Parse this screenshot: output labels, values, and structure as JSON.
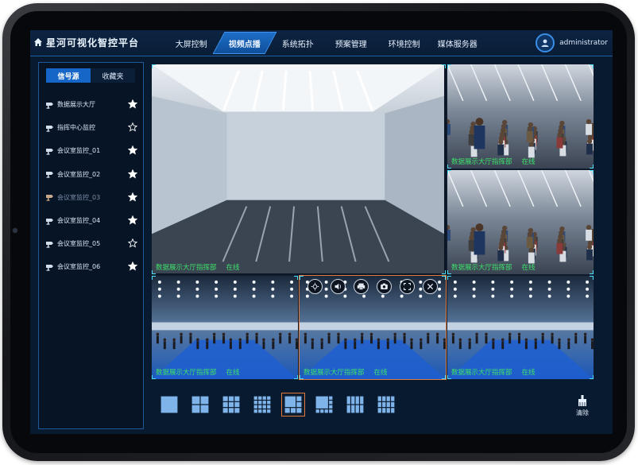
{
  "app": {
    "title": "星河可视化智控平台"
  },
  "nav": {
    "items": [
      "大屏控制",
      "视频点播",
      "系统拓扑",
      "预案管理",
      "环境控制",
      "媒体服务器"
    ],
    "active_index": 1
  },
  "user": {
    "name": "administrator"
  },
  "side": {
    "tabs": [
      "信号源",
      "收藏夹"
    ],
    "active_tab": 0,
    "sources": [
      {
        "label": "数据展示大厅",
        "favorite": true,
        "dim": false
      },
      {
        "label": "指挥中心监控",
        "favorite": false,
        "dim": false
      },
      {
        "label": "会议室监控_01",
        "favorite": true,
        "dim": false
      },
      {
        "label": "会议室监控_02",
        "favorite": true,
        "dim": false
      },
      {
        "label": "会议室监控_03",
        "favorite": true,
        "dim": true
      },
      {
        "label": "会议室监控_04",
        "favorite": true,
        "dim": false
      },
      {
        "label": "会议室监控_05",
        "favorite": false,
        "dim": false
      },
      {
        "label": "会议室监控_06",
        "favorite": true,
        "dim": false
      }
    ]
  },
  "wall": {
    "panes": [
      {
        "caption": "数据展示大厅指挥部",
        "status": "在线",
        "scene": "hall"
      },
      {
        "caption": "数据展示大厅指挥部",
        "status": "在线",
        "scene": "crowd"
      },
      {
        "caption": "数据展示大厅指挥部",
        "status": "在线",
        "scene": "crowd"
      },
      {
        "caption": "数据展示大厅指挥部",
        "status": "在线",
        "scene": "expo"
      },
      {
        "caption": "数据展示大厅指挥部",
        "status": "在线",
        "scene": "expo",
        "selected": true
      },
      {
        "caption": "数据展示大厅指挥部",
        "status": "在线",
        "scene": "expo"
      }
    ],
    "tools": [
      "ptz-icon",
      "audio-icon",
      "print-icon",
      "snapshot-icon",
      "fullscreen-icon",
      "close-icon"
    ]
  },
  "layouts": {
    "options": [
      "1x1",
      "2x2",
      "3x3",
      "4x4",
      "1+5",
      "1+7",
      "2x4",
      "3x4"
    ],
    "active_index": 4
  },
  "toolbar": {
    "clear_label": "清除"
  },
  "colors": {
    "accent": "#1566c6",
    "online": "#3ee06a",
    "selected_border": "#e07a3c",
    "star": "#ffffff"
  }
}
